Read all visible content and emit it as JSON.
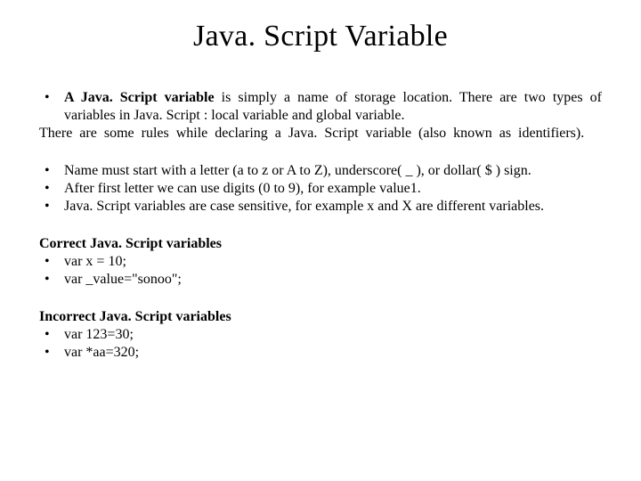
{
  "title": "Java. Script Variable",
  "intro": {
    "dot": "•",
    "lead_bold": "A Java. Script variable",
    "lead_rest": " is simply a name of storage location. There are two types of variables in Java. Script : local variable and global variable.",
    "rules_line": "There are some rules while declaring a Java. Script variable (also known as identifiers)."
  },
  "rules": {
    "dot": "•",
    "r1": "Name must start with a letter (a to z or A to Z), underscore( _ ), or dollar( $ ) sign.",
    "r2": "After first letter we can use digits (0 to 9), for example value1.",
    "r3": "Java. Script variables are case sensitive, for example x and X are different variables."
  },
  "correct": {
    "heading": "Correct Java. Script variables",
    "dot": "•",
    "c1": "var x = 10;",
    "c2": "var _value=\"sonoo\";"
  },
  "incorrect": {
    "heading": "Incorrect Java. Script variables",
    "dot": "•",
    "i1": "var  123=30;",
    "i2": "var *aa=320;"
  }
}
